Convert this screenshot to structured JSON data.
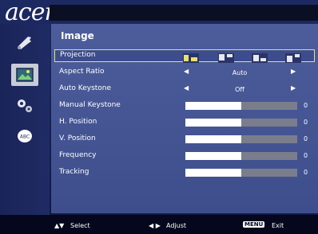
{
  "brand": {
    "logo": "acer"
  },
  "menu": {
    "title": "Image"
  },
  "rows": [
    {
      "label": "Projection",
      "kind": "icons",
      "selected": true
    },
    {
      "label": "Aspect Ratio",
      "kind": "select",
      "value": "Auto"
    },
    {
      "label": "Auto Keystone",
      "kind": "select",
      "value": "Off"
    },
    {
      "label": "Manual Keystone",
      "kind": "slider",
      "value": "0",
      "level": 0.5
    },
    {
      "label": "H. Position",
      "kind": "slider",
      "value": "0",
      "level": 0.5
    },
    {
      "label": "V. Position",
      "kind": "slider",
      "value": "0",
      "level": 0.5
    },
    {
      "label": "Frequency",
      "kind": "slider",
      "value": "0",
      "level": 0.5
    },
    {
      "label": "Tracking",
      "kind": "slider",
      "value": "0",
      "level": 0.5
    }
  ],
  "sidebar": [
    {
      "icon": "wrench-icon"
    },
    {
      "icon": "image-icon",
      "active": true
    },
    {
      "icon": "gears-icon"
    },
    {
      "icon": "language-icon"
    }
  ],
  "footer": {
    "select_hint": "Select",
    "adjust_hint": "Adjust",
    "menu_key": "MENU",
    "exit_hint": "Exit"
  },
  "colors": {
    "highlight": "#e8e26a",
    "panel": "#4d5d9c",
    "slider_fill": "#ffffff",
    "slider_track": "#7a7e8c"
  }
}
